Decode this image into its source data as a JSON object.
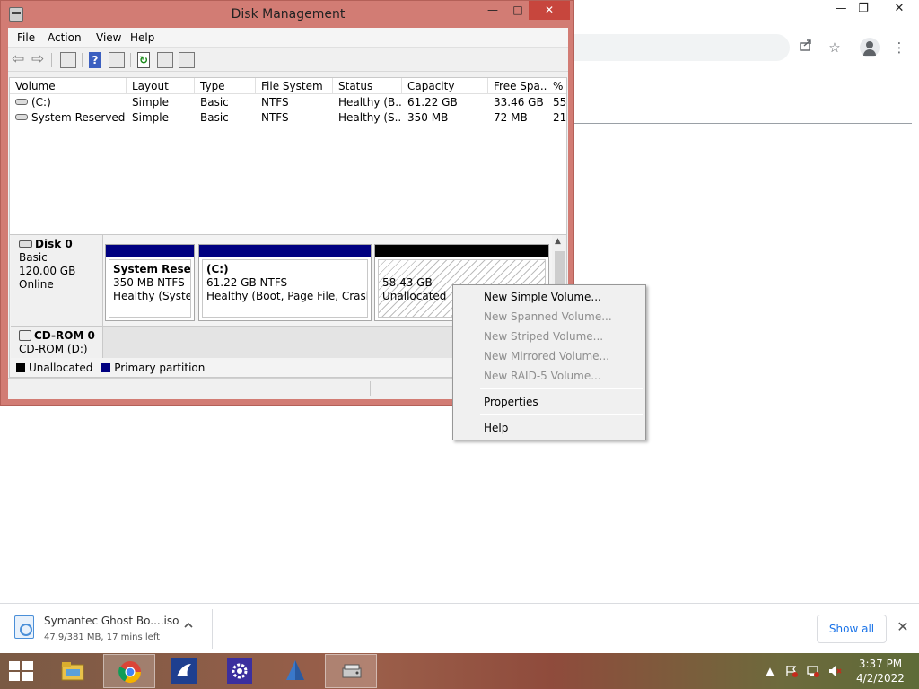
{
  "chrome": {
    "window_controls": {
      "minimize": "—",
      "restore": "❐",
      "close": "✕"
    },
    "icons": {
      "share": "share-icon",
      "bookmark": "☆",
      "menu": "⋮"
    }
  },
  "window": {
    "title": "Disk Management",
    "controls": {
      "minimize": "—",
      "maximize": "□",
      "close": "✕"
    }
  },
  "menu": [
    "File",
    "Action",
    "View",
    "Help"
  ],
  "toolbar": {
    "back": "⇦",
    "forward": "⇨",
    "help": "?",
    "refresh": "↻"
  },
  "volume_list": {
    "columns": [
      "Volume",
      "Layout",
      "Type",
      "File System",
      "Status",
      "Capacity",
      "Free Spa...",
      "% F"
    ],
    "rows": [
      [
        "(C:)",
        "Simple",
        "Basic",
        "NTFS",
        "Healthy (B...",
        "61.22 GB",
        "33.46 GB",
        "55"
      ],
      [
        "System Reserved",
        "Simple",
        "Basic",
        "NTFS",
        "Healthy (S...",
        "350 MB",
        "72 MB",
        "21"
      ]
    ],
    "scroll_left": "<",
    "scroll_right": ">"
  },
  "disks": {
    "disk0": {
      "name": "Disk 0",
      "type": "Basic",
      "size": "120.00 GB",
      "state": "Online",
      "partitions": [
        {
          "name": "System Reserve",
          "size": "350 MB NTFS",
          "status": "Healthy (System,",
          "bar_color": "#000080"
        },
        {
          "name": "(C:)",
          "size": "61.22 GB NTFS",
          "status": "Healthy (Boot, Page File, Crash Du",
          "bar_color": "#000080"
        },
        {
          "size": "58.43 GB",
          "status": "Unallocated",
          "bar_color": "#000000"
        }
      ]
    },
    "cdrom0": {
      "name": "CD-ROM 0",
      "drive": "CD-ROM (D:)"
    }
  },
  "legend": [
    {
      "label": "Unallocated",
      "color": "#000000"
    },
    {
      "label": "Primary partition",
      "color": "#000080"
    }
  ],
  "context_menu": {
    "items": [
      {
        "label": "New Simple Volume...",
        "enabled": true
      },
      {
        "label": "New Spanned Volume...",
        "enabled": false
      },
      {
        "label": "New Striped Volume...",
        "enabled": false
      },
      {
        "label": "New Mirrored Volume...",
        "enabled": false
      },
      {
        "label": "New RAID-5 Volume...",
        "enabled": false
      },
      {
        "label": "Properties",
        "enabled": true
      },
      {
        "label": "Help",
        "enabled": true
      }
    ]
  },
  "download": {
    "file_name": "Symantec Ghost Bo....iso",
    "progress_text": "47.9/381 MB, 17 mins left",
    "show_all": "Show all",
    "close": "✕",
    "chevron": "^"
  },
  "taskbar": {
    "apps": [
      "file-explorer",
      "chrome",
      "app-blue-bird",
      "settings",
      "app-sail",
      "disk-management"
    ],
    "time": "3:37 PM",
    "date": "4/2/2022",
    "tray_up": "▲"
  }
}
